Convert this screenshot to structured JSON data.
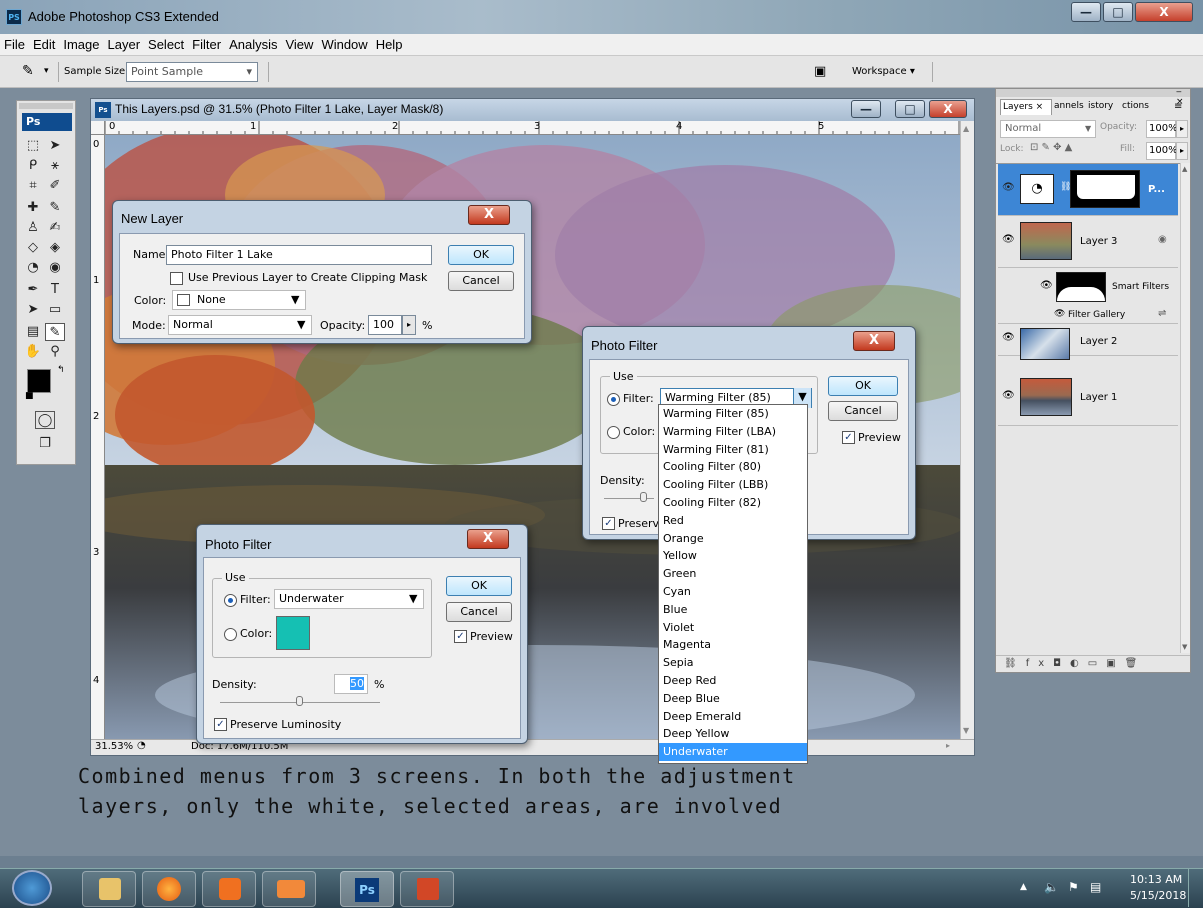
{
  "window": {
    "title": "Adobe Photoshop CS3 Extended",
    "icon": "PS",
    "min": "—",
    "max": "□",
    "close": "X"
  },
  "menubar": [
    "File",
    "Edit",
    "Image",
    "Layer",
    "Select",
    "Filter",
    "Analysis",
    "View",
    "Window",
    "Help"
  ],
  "options": {
    "sample_size_label": "Sample Size:",
    "sample_size_value": "Point Sample",
    "workspace_label": "Workspace ▾"
  },
  "toolbox": {
    "logo": "Ps"
  },
  "document": {
    "icon": "Ps",
    "title": "This Layers.psd @ 31.5% (Photo Filter 1 Lake, Layer Mask/8)",
    "ruler_h": [
      "0",
      "1",
      "2",
      "3",
      "4",
      "5"
    ],
    "ruler_v": [
      "0",
      "1",
      "2",
      "3",
      "4"
    ],
    "zoom": "31.53%",
    "doc_info": "Doc: 17.6M/110.5M"
  },
  "new_layer": {
    "title": "New Layer",
    "name_label": "Name:",
    "name_value": "Photo Filter 1 Lake",
    "clipping_label": "Use Previous Layer to Create Clipping Mask",
    "color_label": "Color:",
    "color_value": "None",
    "mode_label": "Mode:",
    "mode_value": "Normal",
    "opacity_label": "Opacity:",
    "opacity_value": "100",
    "opacity_unit": "%",
    "ok": "OK",
    "cancel": "Cancel"
  },
  "photo_filter_right": {
    "title": "Photo Filter",
    "use_label": "Use",
    "filter_label": "Filter:",
    "filter_value": "Warming Filter (85)",
    "color_label": "Color:",
    "density_label": "Density:",
    "preserve_label": "Preserve",
    "ok": "OK",
    "cancel": "Cancel",
    "preview": "Preview"
  },
  "filter_options": [
    "Warming Filter (85)",
    "Warming Filter (LBA)",
    "Warming Filter (81)",
    "Cooling Filter (80)",
    "Cooling Filter (LBB)",
    "Cooling Filter (82)",
    "Red",
    "Orange",
    "Yellow",
    "Green",
    "Cyan",
    "Blue",
    "Violet",
    "Magenta",
    "Sepia",
    "Deep Red",
    "Deep Blue",
    "Deep Emerald",
    "Deep Yellow",
    "Underwater"
  ],
  "filter_selected": "Underwater",
  "photo_filter_left": {
    "title": "Photo Filter",
    "use_label": "Use",
    "filter_label": "Filter:",
    "filter_value": "Underwater",
    "color_label": "Color:",
    "color_swatch": "#15c0b3",
    "density_label": "Density:",
    "density_value": "50",
    "density_unit": "%",
    "preserve_label": "Preserve Luminosity",
    "ok": "OK",
    "cancel": "Cancel",
    "preview": "Preview"
  },
  "layers_panel": {
    "tabs": [
      "Layers ×",
      "annels",
      "istory",
      "ctions"
    ],
    "blend_mode": "Normal",
    "opacity_label": "Opacity:",
    "opacity_value": "100%",
    "lock_label": "Lock:",
    "fill_label": "Fill:",
    "fill_value": "100%",
    "layers": [
      {
        "name": "P..."
      },
      {
        "name": "Layer 3"
      },
      {
        "name": "Smart Filters"
      },
      {
        "name": "Filter Gallery"
      },
      {
        "name": "Layer 2"
      },
      {
        "name": "Layer 1"
      }
    ]
  },
  "caption": {
    "line1": "Combined menus from 3 screens.  In both the adjustment",
    "line2": "layers, only the white, selected areas, are involved"
  },
  "taskbar": {
    "time": "10:13 AM",
    "date": "5/15/2018",
    "ps_label": "Ps"
  },
  "colors": {
    "accent": "#3399ff",
    "selected_layer": "#3d86d5",
    "swatch": "#15c0b3"
  }
}
